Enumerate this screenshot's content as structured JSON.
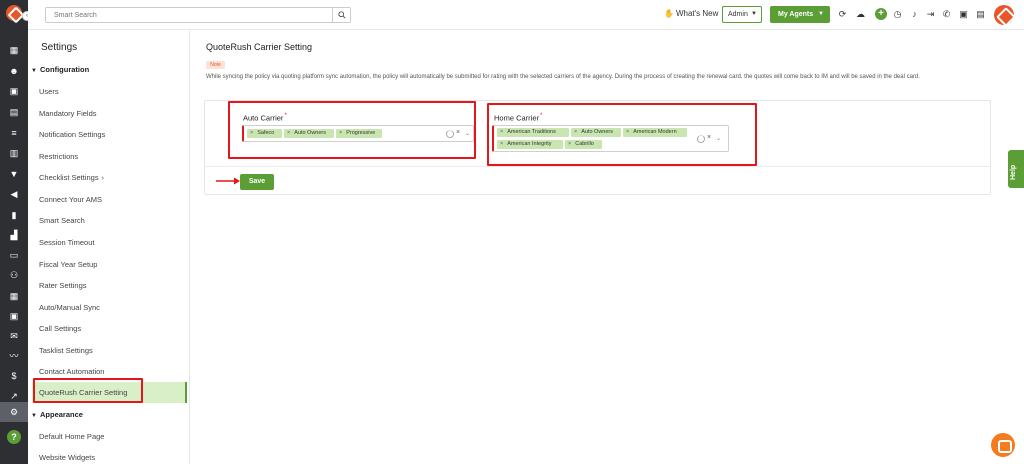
{
  "search": {
    "placeholder": "Smart Search"
  },
  "topbar": {
    "whats_new": "What's New",
    "admin_label": "Admin",
    "agents_label": "My Agents",
    "icons": [
      "refresh-icon",
      "cloud-icon",
      "add-icon",
      "clock-icon",
      "bell-icon",
      "export-icon",
      "phone-icon",
      "chip-icon",
      "document-icon",
      "brand-logo"
    ]
  },
  "rail": {
    "toggle": "‹",
    "icons": [
      "dashboard-icon",
      "contacts-icon",
      "policies-icon",
      "quotes-icon",
      "tasks-icon",
      "reports-icon",
      "filter-icon",
      "campaign-icon",
      "mobile-icon",
      "analytics-icon",
      "folder-icon",
      "people-icon",
      "calendar-icon",
      "pos-icon",
      "email-icon",
      "signature-icon",
      "billing-icon",
      "growth-icon",
      "settings-icon",
      "help-icon"
    ]
  },
  "sidebar": {
    "title": "Settings",
    "group_config": "Configuration",
    "items": [
      {
        "label": "Users"
      },
      {
        "label": "Mandatory Fields"
      },
      {
        "label": "Notification Settings"
      },
      {
        "label": "Restrictions"
      },
      {
        "label": "Checklist Settings"
      },
      {
        "label": "Connect Your AMS"
      },
      {
        "label": "Smart Search"
      },
      {
        "label": "Session Timeout"
      },
      {
        "label": "Fiscal Year Setup"
      },
      {
        "label": "Rater Settings"
      },
      {
        "label": "Auto/Manual Sync"
      },
      {
        "label": "Call Settings"
      },
      {
        "label": "Tasklist Settings"
      },
      {
        "label": "Contact Automation"
      }
    ],
    "active_item": "QuoteRush Carrier Setting",
    "group_appearance": "Appearance",
    "appearance_items": [
      {
        "label": "Default Home Page"
      },
      {
        "label": "Website Widgets"
      }
    ]
  },
  "main": {
    "title": "QuoteRush Carrier Setting",
    "note_badge": "Note",
    "note_text": "While syncing the policy via quoting platform sync automation, the policy will automatically be submitted for rating with the selected carriers of the agency. During the process of creating the renewal card, the quotes will come back to IM and will be saved in the deal card.",
    "auto_carrier": {
      "label": "Auto Carrier",
      "tags": [
        "Safeco",
        "Auto Owners",
        "Progressive"
      ]
    },
    "home_carrier": {
      "label": "Home Carrier",
      "tags": [
        "American Traditions",
        "Auto Owners",
        "American Modern",
        "American Integrity",
        "Cabrillo"
      ]
    },
    "save_label": "Save"
  },
  "help_tab": "Help",
  "colors": {
    "brand_green": "#5a9e35",
    "brand_orange": "#e8572b",
    "highlight_red": "#e3161b",
    "tag_green": "#c9e6b1"
  }
}
